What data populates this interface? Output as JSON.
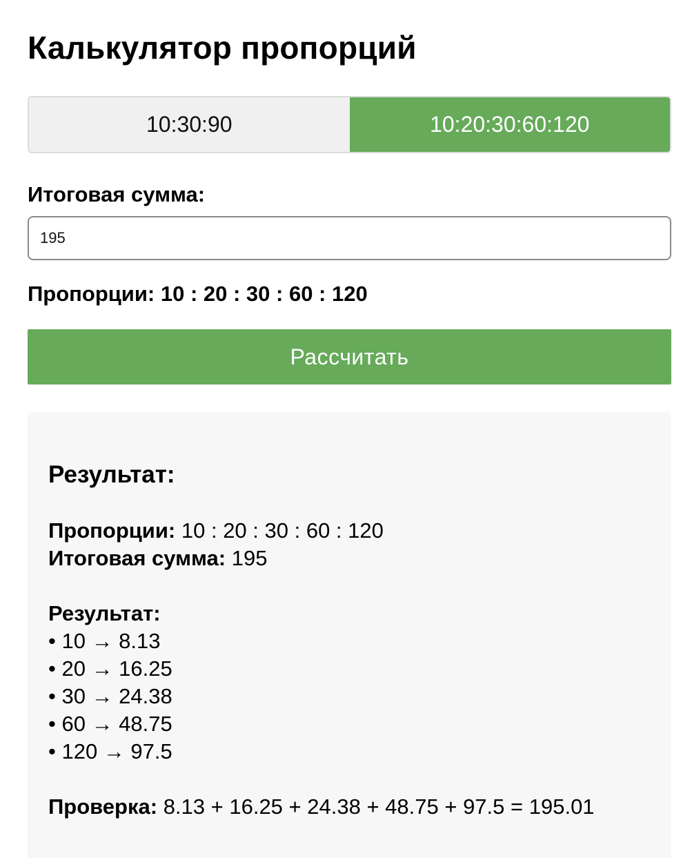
{
  "header": {
    "title": "Калькулятор пропорций"
  },
  "tabs": [
    {
      "label": "10:30:90",
      "active": false
    },
    {
      "label": "10:20:30:60:120",
      "active": true
    }
  ],
  "form": {
    "sum_label": "Итоговая сумма:",
    "sum_value": "195",
    "proportions_label": "Пропорции:",
    "proportions_value": "10 : 20 : 30 : 60 : 120",
    "calculate_label": "Рассчитать"
  },
  "result": {
    "heading": "Результат:",
    "proportions_label": "Пропорции:",
    "proportions_value": "10 : 20 : 30 : 60 : 120",
    "sum_label": "Итоговая сумма:",
    "sum_value": "195",
    "list_label": "Результат:",
    "items": [
      "• 10 → 8.13",
      "• 20 → 16.25",
      "• 30 → 24.38",
      "• 60 → 48.75",
      "• 120 → 97.5"
    ],
    "check_label": "Проверка:",
    "check_value": "8.13 + 16.25 + 24.38 + 48.75 + 97.5 = 195.01"
  },
  "colors": {
    "accent": "#66aa5a",
    "tab_inactive": "#f0f0f0",
    "card_background": "#f7f7f7"
  }
}
